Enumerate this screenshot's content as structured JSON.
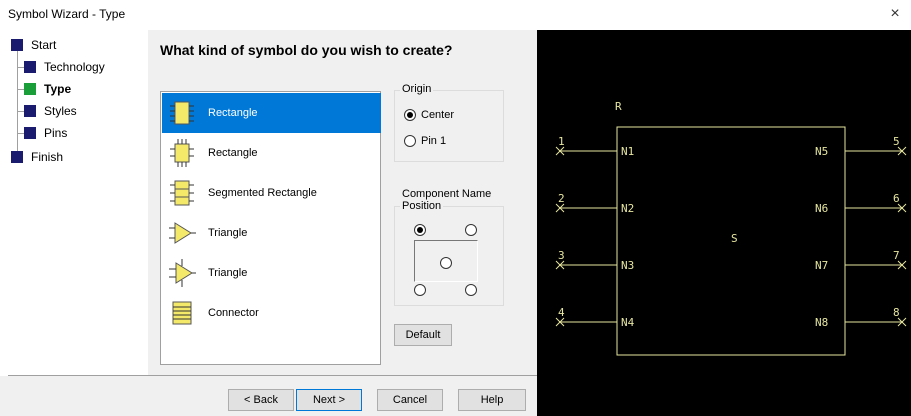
{
  "window": {
    "title": "Symbol Wizard - Type",
    "close_glyph": "×"
  },
  "steps": [
    {
      "label": "Start",
      "active": false
    },
    {
      "label": "Technology",
      "active": false
    },
    {
      "label": "Type",
      "active": true
    },
    {
      "label": "Styles",
      "active": false
    },
    {
      "label": "Pins",
      "active": false
    },
    {
      "label": "Finish",
      "active": false
    }
  ],
  "main": {
    "heading": "What kind of symbol do you wish to create?",
    "symbol_types": [
      {
        "label": "Rectangle",
        "icon": "rectangle-icon",
        "selected": true
      },
      {
        "label": "Rectangle",
        "icon": "rectangle-pins-icon",
        "selected": false
      },
      {
        "label": "Segmented Rectangle",
        "icon": "segmented-rectangle-icon",
        "selected": false
      },
      {
        "label": "Triangle",
        "icon": "triangle-icon",
        "selected": false
      },
      {
        "label": "Triangle",
        "icon": "triangle-pins-icon",
        "selected": false
      },
      {
        "label": "Connector",
        "icon": "connector-icon",
        "selected": false
      }
    ],
    "origin": {
      "label": "Origin",
      "options": [
        {
          "label": "Center",
          "checked": true
        },
        {
          "label": "Pin 1",
          "checked": false
        }
      ]
    },
    "component_name_position": {
      "label_line1": "Component Name",
      "label_line2": "Position",
      "selected": "top-left"
    },
    "default_button": "Default"
  },
  "footer": {
    "back": "< Back",
    "next": "Next >",
    "cancel": "Cancel",
    "help": "Help"
  },
  "preview": {
    "ref_label": "R",
    "center_label": "S",
    "left_pins": [
      {
        "number": "1",
        "name": "N1"
      },
      {
        "number": "2",
        "name": "N2"
      },
      {
        "number": "3",
        "name": "N3"
      },
      {
        "number": "4",
        "name": "N4"
      }
    ],
    "right_pins": [
      {
        "number": "5",
        "name": "N5"
      },
      {
        "number": "6",
        "name": "N6"
      },
      {
        "number": "7",
        "name": "N7"
      },
      {
        "number": "8",
        "name": "N8"
      }
    ],
    "colors": {
      "background": "#000000",
      "line": "#e6e6a0",
      "accent_blue": "#0078d7",
      "active_step": "#1a9e3a",
      "step": "#1a1a6e"
    }
  }
}
